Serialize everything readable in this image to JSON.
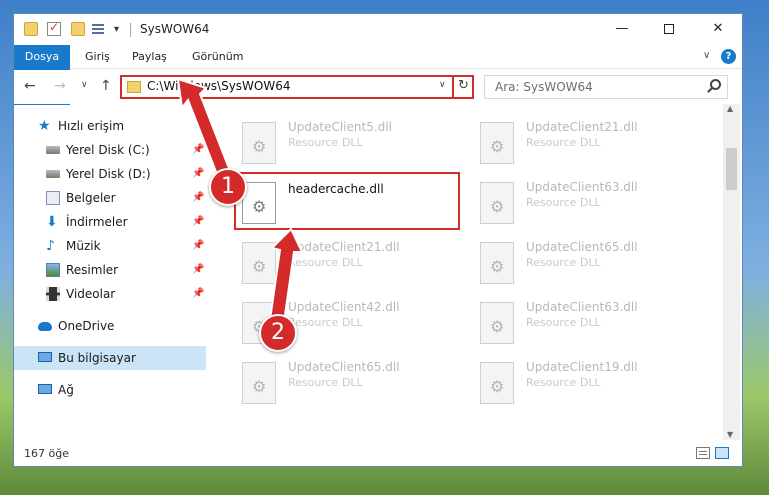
{
  "window": {
    "title": "SysWOW64",
    "controls": {
      "minimize": "—",
      "maximize": "",
      "close": "✕"
    }
  },
  "quick_access_toolbar": {
    "arrow": "▾"
  },
  "ribbon": {
    "tabs": [
      "Dosya",
      "Giriş",
      "Paylaş",
      "Görünüm"
    ],
    "chevron": "∨",
    "help": "?"
  },
  "navigation": {
    "back": "←",
    "forward": "→",
    "recent": "∨",
    "up": "↑",
    "address": "C:\\Windows\\SysWOW64",
    "address_dropdown": "∨",
    "refresh": "↻",
    "search_placeholder": "Ara: SysWOW64"
  },
  "sidebar": {
    "items": [
      {
        "label": "Hızlı erişim",
        "icon": "star-icon",
        "pinned": false
      },
      {
        "label": "Yerel Disk (C:)",
        "icon": "drive-icon",
        "pinned": true
      },
      {
        "label": "Yerel Disk (D:)",
        "icon": "drive-icon",
        "pinned": true
      },
      {
        "label": "Belgeler",
        "icon": "documents-icon",
        "pinned": true
      },
      {
        "label": "İndirmeler",
        "icon": "download-icon",
        "pinned": true
      },
      {
        "label": "Müzik",
        "icon": "music-icon",
        "pinned": true
      },
      {
        "label": "Resimler",
        "icon": "pictures-icon",
        "pinned": true
      },
      {
        "label": "Videolar",
        "icon": "video-icon",
        "pinned": true
      },
      {
        "label": "OneDrive",
        "icon": "cloud-icon",
        "pinned": false
      },
      {
        "label": "Bu bilgisayar",
        "icon": "computer-icon",
        "pinned": false,
        "selected": true
      },
      {
        "label": "Ağ",
        "icon": "network-icon",
        "pinned": false
      }
    ],
    "pin_glyph": "📌"
  },
  "files": [
    {
      "name": "UpdateClient5.dll",
      "type": "Resource DLL"
    },
    {
      "name": "UpdateClient21.dll",
      "type": "Resource DLL"
    },
    {
      "name": "headercache.dll",
      "type": "",
      "highlighted": true
    },
    {
      "name": "UpdateClient63.dll",
      "type": "Resource DLL"
    },
    {
      "name": "UpdateClient21.dll",
      "type": "Resource DLL"
    },
    {
      "name": "UpdateClient65.dll",
      "type": "Resource DLL"
    },
    {
      "name": "UpdateClient42.dll",
      "type": "Resource DLL"
    },
    {
      "name": "UpdateClient63.dll",
      "type": "Resource DLL"
    },
    {
      "name": "UpdateClient65.dll",
      "type": "Resource DLL"
    },
    {
      "name": "UpdateClient19.dll",
      "type": "Resource DLL"
    }
  ],
  "scrollbar": {
    "up": "▲",
    "down": "▼"
  },
  "status": {
    "item_count": "167 öğe"
  },
  "annotations": {
    "step1": "1",
    "step2": "2",
    "color": "#d42a2a"
  }
}
